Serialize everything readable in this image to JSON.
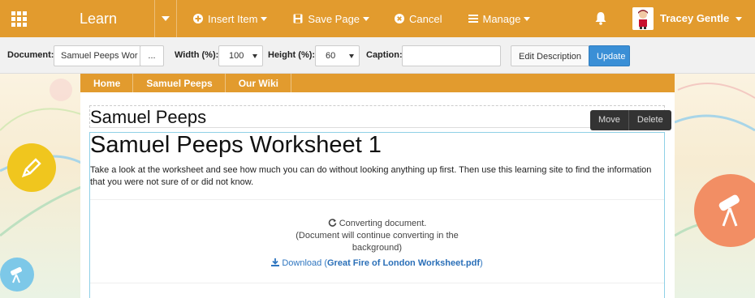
{
  "header": {
    "app_name": "Learn",
    "insert_item": "Insert Item",
    "save_page": "Save Page",
    "cancel": "Cancel",
    "manage": "Manage",
    "user_name": "Tracey Gentle",
    "brand_color": "#e29b2e"
  },
  "toolbar": {
    "document_label": "Document:",
    "document_value": "Samuel Peeps Wor",
    "browse_label": "...",
    "width_label": "Width (%):",
    "width_value": "100",
    "height_label": "Height (%):",
    "height_value": "60",
    "caption_label": "Caption:",
    "caption_value": "",
    "edit_description": "Edit Description",
    "update": "Update"
  },
  "page_nav": [
    "Home",
    "Samuel Peeps",
    "Our Wiki"
  ],
  "section": {
    "title": "Samuel Peeps",
    "move": "Move",
    "delete": "Delete"
  },
  "content": {
    "heading": "Samuel Peeps Worksheet 1",
    "description": "Take a look at the worksheet and see how much you can do without looking anything up first. Then use this learning site to find the information that you were not sure of or did not know.",
    "converting": "Converting document.",
    "converting_note": "(Document will continue converting in the background)",
    "download_prefix": "Download (",
    "download_file": "Great Fire of London Worksheet.pdf",
    "download_suffix": ")"
  }
}
